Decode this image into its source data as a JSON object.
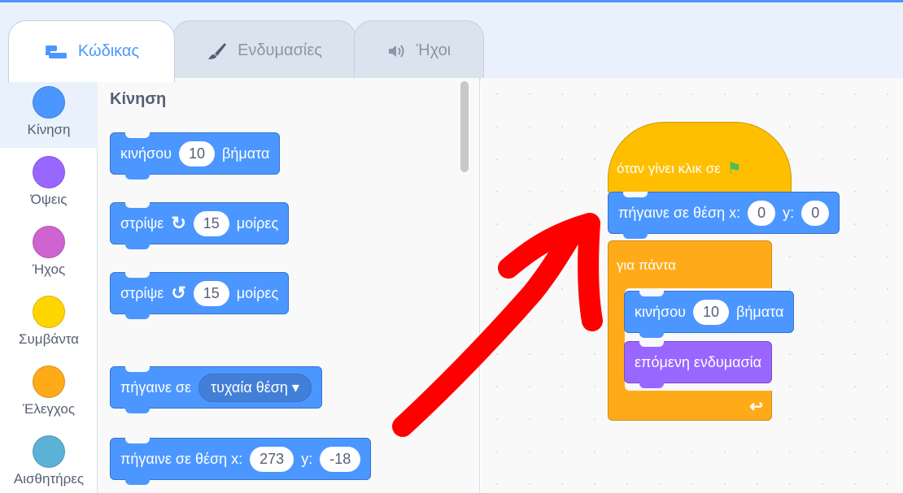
{
  "tabs": {
    "code": {
      "label": "Κώδικας",
      "icon": "code-icon"
    },
    "costumes": {
      "label": "Ενδυμασίες",
      "icon": "paintbrush-icon"
    },
    "sounds": {
      "label": "Ήχοι",
      "icon": "speaker-icon"
    }
  },
  "categories": [
    {
      "label": "Κίνηση",
      "color": "#4c97ff"
    },
    {
      "label": "Όψεις",
      "color": "#9966ff"
    },
    {
      "label": "Ήχος",
      "color": "#cf63cf"
    },
    {
      "label": "Συμβάντα",
      "color": "#ffd500"
    },
    {
      "label": "Έλεγχος",
      "color": "#ffab19"
    },
    {
      "label": "Αισθητήρες",
      "color": "#5cb1d6"
    }
  ],
  "palette": {
    "title": "Κίνηση",
    "move": {
      "text": "κινήσου",
      "value": "10",
      "suffix": "βήματα"
    },
    "turn_right": {
      "text": "στρίψε",
      "value": "15",
      "suffix": "μοίρες"
    },
    "turn_left": {
      "text": "στρίψε",
      "value": "15",
      "suffix": "μοίρες"
    },
    "goto": {
      "text": "πήγαινε σε",
      "option": "τυχαία θέση"
    },
    "goto_xy": {
      "text": "πήγαινε σε θέση x:",
      "x": "273",
      "ylabel": "y:",
      "y": "-18"
    }
  },
  "script": {
    "hat": {
      "text": "όταν γίνει κλικ σε"
    },
    "goto_xy": {
      "text": "πήγαινε σε θέση x:",
      "x": "0",
      "ylabel": "y:",
      "y": "0"
    },
    "forever": {
      "text": "για πάντα"
    },
    "move": {
      "text": "κινήσου",
      "value": "10",
      "suffix": "βήματα"
    },
    "next_costume": {
      "text": "επόμενη ενδυμασία"
    }
  },
  "colors": {
    "motion": "#4c97ff",
    "looks": "#9966ff",
    "events": "#ffbf00",
    "control": "#ffab19",
    "annotation": "#ff0000"
  }
}
